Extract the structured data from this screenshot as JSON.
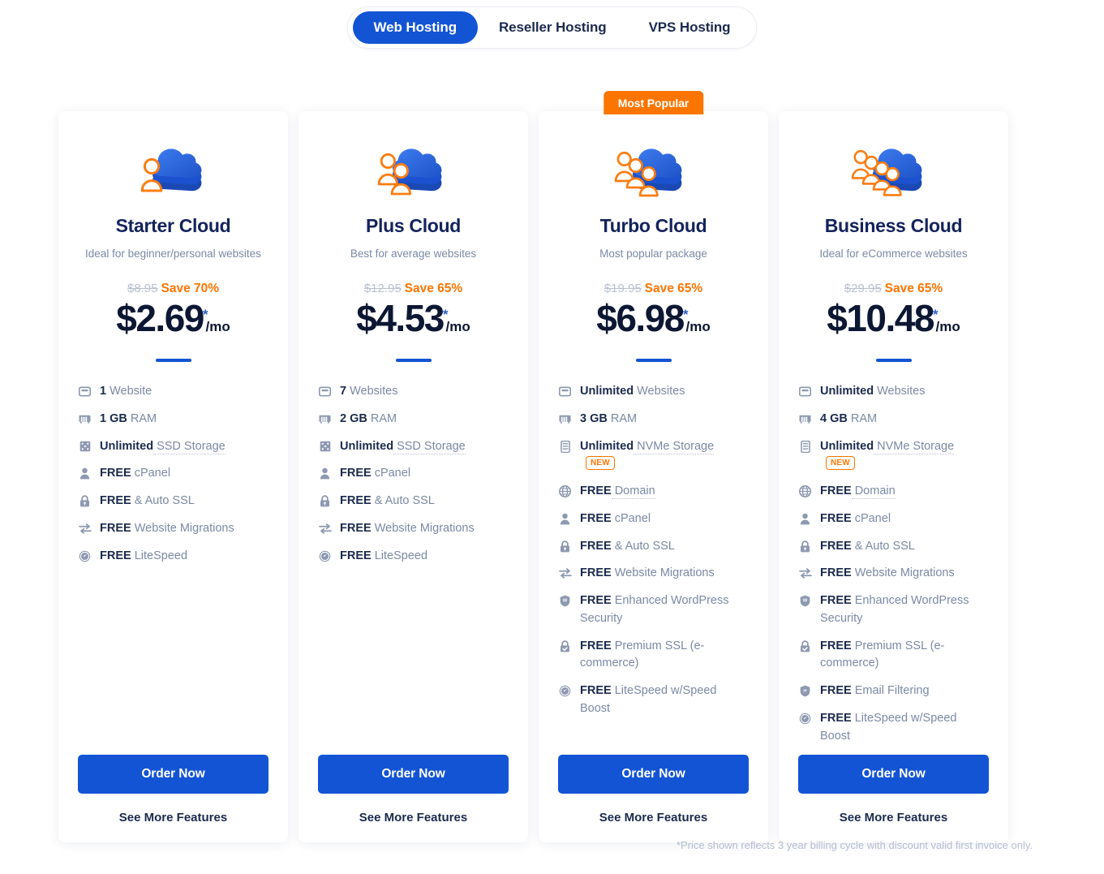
{
  "tabs": {
    "items": [
      {
        "label": "Web Hosting",
        "active": true
      },
      {
        "label": "Reseller Hosting",
        "active": false
      },
      {
        "label": "VPS Hosting",
        "active": false
      }
    ]
  },
  "colors": {
    "brand_blue": "#1354d4",
    "accent_orange": "#fb7500",
    "heading_navy": "#13235b",
    "muted_text": "#7b89a5",
    "icon_gray": "#8d99b0"
  },
  "common": {
    "order_label": "Order Now",
    "see_more_label": "See More Features",
    "popular_badge": "Most Popular",
    "new_badge": "NEW",
    "per_month": "/mo",
    "star": "*"
  },
  "disclaimer": "*Price shown reflects 3 year billing cycle with discount valid first invoice only.",
  "plans": [
    {
      "name": "Starter Cloud",
      "desc": "Ideal for beginner/personal websites",
      "old_price": "$8.95",
      "save": "Save 70%",
      "price": "$2.69",
      "people": 1,
      "popular": false,
      "features": [
        {
          "icon": "monitor-icon",
          "strong": "1",
          "rest": " Website",
          "tip": false,
          "badge": null
        },
        {
          "icon": "ram-icon",
          "strong": "1 GB",
          "rest": " RAM",
          "tip": false,
          "badge": null
        },
        {
          "icon": "ssd-icon",
          "strong": "Unlimited",
          "rest": " SSD Storage",
          "tip": true,
          "badge": null
        },
        {
          "icon": "person-icon",
          "strong": "FREE",
          "rest": " cPanel",
          "tip": false,
          "badge": null
        },
        {
          "icon": "lock-icon",
          "strong": "FREE",
          "rest": " & Auto SSL",
          "tip": false,
          "badge": null
        },
        {
          "icon": "migration-icon",
          "strong": "FREE",
          "rest": " Website Migrations",
          "tip": false,
          "badge": null
        },
        {
          "icon": "speedometer-icon",
          "strong": "FREE",
          "rest": " LiteSpeed",
          "tip": false,
          "badge": null
        }
      ]
    },
    {
      "name": "Plus Cloud",
      "desc": "Best for average websites",
      "old_price": "$12.95",
      "save": "Save 65%",
      "price": "$4.53",
      "people": 2,
      "popular": false,
      "features": [
        {
          "icon": "monitor-icon",
          "strong": "7",
          "rest": " Websites",
          "tip": false,
          "badge": null
        },
        {
          "icon": "ram-icon",
          "strong": "2 GB",
          "rest": " RAM",
          "tip": false,
          "badge": null
        },
        {
          "icon": "ssd-icon",
          "strong": "Unlimited",
          "rest": " SSD Storage",
          "tip": true,
          "badge": null
        },
        {
          "icon": "person-icon",
          "strong": "FREE",
          "rest": " cPanel",
          "tip": false,
          "badge": null
        },
        {
          "icon": "lock-icon",
          "strong": "FREE",
          "rest": " & Auto SSL",
          "tip": false,
          "badge": null
        },
        {
          "icon": "migration-icon",
          "strong": "FREE",
          "rest": " Website Migrations",
          "tip": false,
          "badge": null
        },
        {
          "icon": "speedometer-icon",
          "strong": "FREE",
          "rest": " LiteSpeed",
          "tip": false,
          "badge": null
        }
      ]
    },
    {
      "name": "Turbo Cloud",
      "desc": "Most popular package",
      "old_price": "$19.95",
      "save": "Save 65%",
      "price": "$6.98",
      "people": 3,
      "popular": true,
      "features": [
        {
          "icon": "monitor-icon",
          "strong": "Unlimited",
          "rest": " Websites",
          "tip": false,
          "badge": null
        },
        {
          "icon": "ram-icon",
          "strong": "3 GB",
          "rest": " RAM",
          "tip": false,
          "badge": null
        },
        {
          "icon": "nvme-icon",
          "strong": "Unlimited",
          "rest": " NVMe Storage",
          "tip": true,
          "badge": "NEW"
        },
        {
          "icon": "globe-icon",
          "strong": "FREE",
          "rest": " Domain",
          "tip": true,
          "badge": null
        },
        {
          "icon": "person-icon",
          "strong": "FREE",
          "rest": " cPanel",
          "tip": false,
          "badge": null
        },
        {
          "icon": "lock-icon",
          "strong": "FREE",
          "rest": " & Auto SSL",
          "tip": false,
          "badge": null
        },
        {
          "icon": "migration-icon",
          "strong": "FREE",
          "rest": " Website Migrations",
          "tip": false,
          "badge": null
        },
        {
          "icon": "wordpress-shield-icon",
          "strong": "FREE",
          "rest": " Enhanced WordPress Security",
          "tip": false,
          "badge": null
        },
        {
          "icon": "premium-lock-icon",
          "strong": "FREE",
          "rest": " Premium SSL (e-commerce)",
          "tip": false,
          "badge": null
        },
        {
          "icon": "speedometer-icon",
          "strong": "FREE",
          "rest": " LiteSpeed w/Speed Boost",
          "tip": false,
          "badge": null
        }
      ]
    },
    {
      "name": "Business Cloud",
      "desc": "Ideal for eCommerce websites",
      "old_price": "$29.95",
      "save": "Save 65%",
      "price": "$10.48",
      "people": 4,
      "popular": false,
      "features": [
        {
          "icon": "monitor-icon",
          "strong": "Unlimited",
          "rest": " Websites",
          "tip": false,
          "badge": null
        },
        {
          "icon": "ram-icon",
          "strong": "4 GB",
          "rest": " RAM",
          "tip": false,
          "badge": null
        },
        {
          "icon": "nvme-icon",
          "strong": "Unlimited",
          "rest": " NVMe Storage",
          "tip": true,
          "badge": "NEW"
        },
        {
          "icon": "globe-icon",
          "strong": "FREE",
          "rest": " Domain",
          "tip": true,
          "badge": null
        },
        {
          "icon": "person-icon",
          "strong": "FREE",
          "rest": " cPanel",
          "tip": false,
          "badge": null
        },
        {
          "icon": "lock-icon",
          "strong": "FREE",
          "rest": " & Auto SSL",
          "tip": false,
          "badge": null
        },
        {
          "icon": "migration-icon",
          "strong": "FREE",
          "rest": " Website Migrations",
          "tip": false,
          "badge": null
        },
        {
          "icon": "wordpress-shield-icon",
          "strong": "FREE",
          "rest": " Enhanced WordPress Security",
          "tip": false,
          "badge": null
        },
        {
          "icon": "premium-lock-icon",
          "strong": "FREE",
          "rest": " Premium SSL (e-commerce)",
          "tip": false,
          "badge": null
        },
        {
          "icon": "email-filter-icon",
          "strong": "FREE",
          "rest": " Email Filtering",
          "tip": false,
          "badge": null
        },
        {
          "icon": "speedometer-icon",
          "strong": "FREE",
          "rest": " LiteSpeed w/Speed Boost",
          "tip": false,
          "badge": null
        }
      ]
    }
  ]
}
